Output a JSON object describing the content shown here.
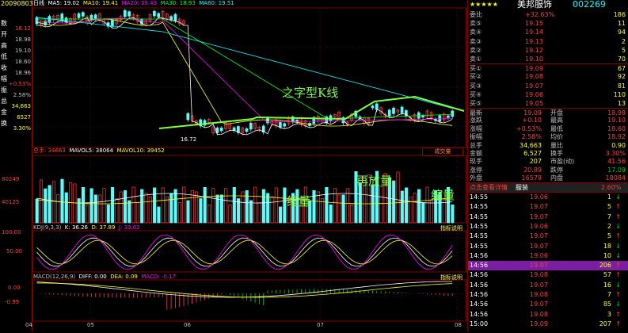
{
  "left_panel": {
    "date": "20090803",
    "labels": [
      {
        "k": "数",
        "v": "18.12"
      },
      {
        "k": "开",
        "v": "18.98"
      },
      {
        "k": "高",
        "v": "19.10"
      },
      {
        "k": "低",
        "v": "18.60"
      },
      {
        "k": "收",
        "v": "18.96"
      },
      {
        "k": "幅",
        "v": "+0.53%"
      },
      {
        "k": "振",
        "v": "2.58%"
      },
      {
        "k": "总",
        "v": "34,663"
      },
      {
        "k": "金",
        "v": "6527"
      },
      {
        "k": "换",
        "v": "3.30%"
      }
    ]
  },
  "main_chart": {
    "header": {
      "tab": "日线",
      "ma5": "MA5: 19.02",
      "ma10": "MA10: 19.41",
      "ma20": "MA20: 19.43",
      "ma30": "MA30: 18.93",
      "ma60": "MA60: 19.51"
    },
    "low_label": "16.72",
    "annotation": "之字型K线",
    "colors": {
      "ma5": "#ffffff",
      "ma10": "#ffff00",
      "ma20": "#ff00ff",
      "ma30": "#00ff00",
      "ma60": "#00ffff",
      "up": "#ff3c3c",
      "down": "#54ffff",
      "zigzag": "#7cff3c"
    }
  },
  "volume_chart": {
    "header": {
      "total": "总手: 34663",
      "mavol5": "MAVOL5: 38064",
      "mavol10": "MAVOL10: 39452"
    },
    "button": "成交量",
    "ylabels": [
      "80249",
      "40125"
    ],
    "annotations": [
      "缩量",
      "再放量",
      "缩量"
    ]
  },
  "kdj_chart": {
    "header": {
      "name": "KDJ(9,3,3)",
      "k": "K: 36.26",
      "d": "D: 37.89",
      "j": "J: 33.02"
    },
    "button": "指标说明",
    "ylabels": [
      "100.00",
      "50.00",
      "0.00"
    ]
  },
  "macd_chart": {
    "header": {
      "name": "MACD(12,26,9)",
      "diff": "DIFF: 0.00",
      "dea": "DEA: 0.09",
      "macd": "MACD: -0.17"
    },
    "button": "指标说明",
    "ylabels": [
      "0.00",
      "-0.99"
    ]
  },
  "xaxis": [
    "04",
    "05",
    "06",
    "07",
    "08"
  ],
  "quote_panel": {
    "stars": "★★★★★",
    "stock_name": "美邦服饰",
    "stock_code": "002269",
    "top": [
      {
        "k": "委比",
        "v1": "+32.63%",
        "v2": "186"
      },
      {
        "k": "卖⑤",
        "v1": "19.15",
        "v2": "11"
      },
      {
        "k": "卖④",
        "v1": "19.14",
        "v2": "94"
      },
      {
        "k": "卖③",
        "v1": "19.13",
        "v2": "2"
      },
      {
        "k": "卖②",
        "v1": "19.12",
        "v2": "5"
      },
      {
        "k": "卖①",
        "v1": "19.10",
        "v2": "70"
      },
      {
        "k": "买①",
        "v1": "19.09",
        "v2": "67"
      },
      {
        "k": "买②",
        "v1": "19.08",
        "v2": "92"
      },
      {
        "k": "买③",
        "v1": "19.07",
        "v2": "81"
      },
      {
        "k": "买④",
        "v1": "19.06",
        "v2": "110"
      },
      {
        "k": "买⑤",
        "v1": "19.05",
        "v2": "13"
      }
    ],
    "stats": [
      {
        "k1": "最新",
        "v1": "19.09",
        "k2": "开盘",
        "v2": "18.98"
      },
      {
        "k1": "涨跌",
        "v1": "+0.10",
        "k2": "最高",
        "v2": "19.10"
      },
      {
        "k1": "涨幅",
        "v1": "+0.53%",
        "k2": "最低",
        "v2": "18.60"
      },
      {
        "k1": "振幅",
        "v1": "2.58%",
        "k2": "均价",
        "v2": "18.92"
      },
      {
        "k1": "总手",
        "v1": "34,663",
        "k2": "量比",
        "v2": "0.90"
      },
      {
        "k1": "金额",
        "v1": "6,527",
        "k2": "换手",
        "v2": "3.30%"
      },
      {
        "k1": "现手",
        "v1": "207",
        "k2": "市盈(动)",
        "v2": "41.56"
      },
      {
        "k1": "涨停",
        "v1": "20.89",
        "k2": "跌停",
        "v2": "17.09"
      },
      {
        "k1": "外盘",
        "v1": "16579",
        "k2": "内盘",
        "v2": "18084"
      }
    ],
    "detail_bar": {
      "left": "点击查看详情",
      "mid": "服装",
      "right": "2.60%"
    },
    "ticks": [
      {
        "t": "14:55",
        "p": "19.06",
        "v": "1",
        "d": "down"
      },
      {
        "t": "14:55",
        "p": "19.07",
        "v": "5",
        "d": "up"
      },
      {
        "t": "14:55",
        "p": "19.07",
        "v": "7",
        "d": "up"
      },
      {
        "t": "14:55",
        "p": "19.06",
        "v": "2",
        "d": "down"
      },
      {
        "t": "14:55",
        "p": "19.07",
        "v": "5",
        "d": "up"
      },
      {
        "t": "14:55",
        "p": "19.07",
        "v": "18",
        "d": "down"
      },
      {
        "t": "14:56",
        "p": "19.06",
        "v": "10",
        "d": "down"
      },
      {
        "t": "14:56",
        "p": "19.07",
        "v": "206",
        "d": "up"
      },
      {
        "t": "14:56",
        "p": "19.08",
        "v": "57",
        "d": "up"
      },
      {
        "t": "14:56",
        "p": "19.07",
        "v": "16",
        "d": "down"
      },
      {
        "t": "14:56",
        "p": "19.08",
        "v": "7",
        "d": "up"
      },
      {
        "t": "14:56",
        "p": "19.07",
        "v": "85",
        "d": "down"
      },
      {
        "t": "14:56",
        "p": "19.08",
        "v": "3",
        "d": "up"
      },
      {
        "t": "15:00",
        "p": "19.09",
        "v": "207",
        "d": "up"
      }
    ]
  }
}
